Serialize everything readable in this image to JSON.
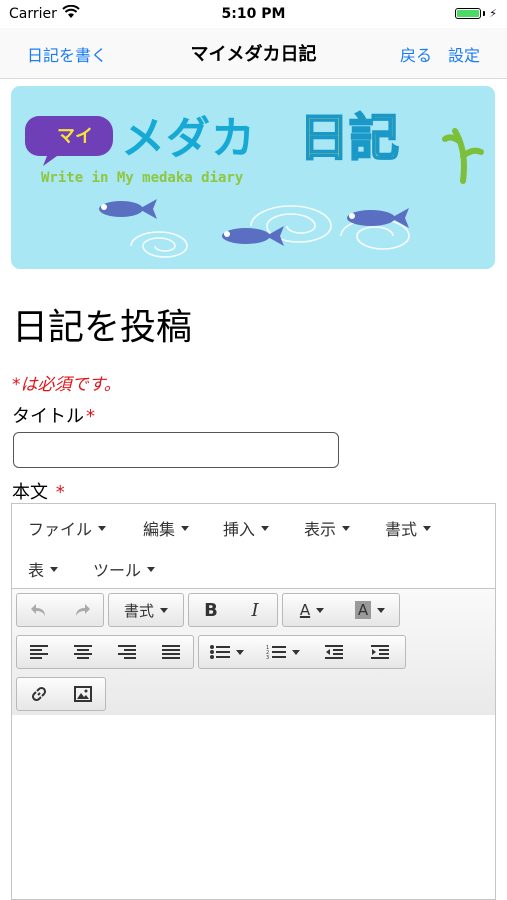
{
  "status_bar": {
    "carrier": "Carrier",
    "time": "5:10 PM"
  },
  "nav": {
    "left_button": "日記を書く",
    "title": "マイメダカ日記",
    "back_button": "戻る",
    "settings_button": "設定"
  },
  "banner": {
    "bubble_text": "マイ",
    "main_text": "メダカ",
    "diary_text": "日記",
    "subtitle": "Write in My medaka diary"
  },
  "form": {
    "heading": "日記を投稿",
    "required_note": "*は必須です。",
    "title_label": "タイトル",
    "title_required_mark": "*",
    "title_value": "",
    "body_label": "本文",
    "body_required_mark": "*"
  },
  "editor": {
    "menu": [
      "ファイル",
      "編集",
      "挿入",
      "表示",
      "書式",
      "表",
      "ツール"
    ],
    "format_label": "書式",
    "bold": "B",
    "italic": "I",
    "font_color": "A",
    "bg_color": "A",
    "body_text": ""
  },
  "colors": {
    "accent": "#1a7cf6",
    "required": "#e0151b",
    "banner_bg": "#a8e7f3"
  },
  "icons": [
    "wifi-icon",
    "battery-icon",
    "undo-icon",
    "redo-icon",
    "align-left-icon",
    "align-center-icon",
    "align-right-icon",
    "align-justify-icon",
    "bullet-list-icon",
    "numbered-list-icon",
    "outdent-icon",
    "indent-icon",
    "link-icon",
    "image-icon"
  ]
}
